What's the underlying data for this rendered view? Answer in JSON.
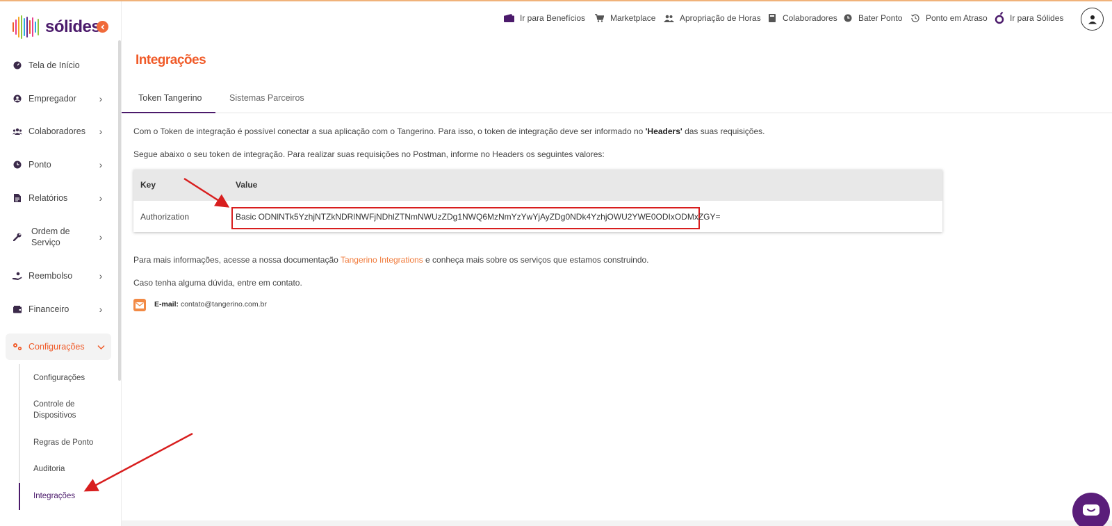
{
  "brand": {
    "name": "sólides",
    "bar_colors": [
      "#f05a28",
      "#e83e8c",
      "#f5a623",
      "#8cc63f",
      "#29abe2",
      "#662d91",
      "#f05a28",
      "#e83e8c",
      "#29abe2",
      "#8cc63f"
    ]
  },
  "colors": {
    "accent": "#f05a28",
    "brand_purple": "#4b1a6b",
    "highlight_red": "#d81e1e",
    "link": "#f07a3a"
  },
  "topbar": {
    "items": [
      {
        "label": "Ir para Benefícios",
        "icon": "wallet-icon"
      },
      {
        "label": "Marketplace",
        "icon": "cart-icon"
      },
      {
        "label": "Apropriação de Horas",
        "icon": "people-icon"
      },
      {
        "label": "Colaboradores",
        "icon": "book-icon"
      },
      {
        "label": "Bater Ponto",
        "icon": "clock-icon"
      },
      {
        "label": "Ponto em Atraso",
        "icon": "history-icon"
      },
      {
        "label": "Ir para Sólides",
        "icon": "solides-icon"
      }
    ]
  },
  "sidebar": {
    "items": [
      {
        "label": "Tela de Início",
        "icon": "dashboard-icon"
      },
      {
        "label": "Empregador",
        "icon": "user-circle-icon"
      },
      {
        "label": "Colaboradores",
        "icon": "users-icon"
      },
      {
        "label": "Ponto",
        "icon": "clock-icon"
      },
      {
        "label": "Relatórios",
        "icon": "document-icon"
      },
      {
        "label": "Ordem de Serviço",
        "icon": "wrench-icon"
      },
      {
        "label": "Reembolso",
        "icon": "hand-coin-icon"
      },
      {
        "label": "Financeiro",
        "icon": "wallet-icon"
      },
      {
        "label": "Configurações",
        "icon": "gears-icon"
      }
    ],
    "subitems": [
      {
        "label": "Configurações"
      },
      {
        "label": "Controle de Dispositivos"
      },
      {
        "label": "Regras de Ponto"
      },
      {
        "label": "Auditoria"
      },
      {
        "label": "Integrações"
      }
    ]
  },
  "main": {
    "title": "Integrações",
    "tabs": [
      {
        "label": "Token Tangerino"
      },
      {
        "label": "Sistemas Parceiros"
      }
    ],
    "intro_a": "Com o Token de integração é possível conectar a sua aplicação com o Tangerino. Para isso, o token de integração deve ser informado no ",
    "intro_bold": "'Headers'",
    "intro_b": " das suas requisições.",
    "below": "Segue abaixo o seu token de integração. Para realizar suas requisições no Postman, informe no Headers os seguintes valores:",
    "table": {
      "headers": [
        "Key",
        "Value"
      ],
      "rows": [
        [
          "Authorization",
          "Basic ODNlNTk5YzhjNTZkNDRlNWFjNDhlZTNmNWUzZDg1NWQ6MzNmYzYwYjAyZDg0NDk4YzhjOWU2YWE0ODIxODMxZGY="
        ]
      ]
    },
    "more_a": "Para mais informações, acesse a nossa documentação ",
    "more_link": "Tangerino Integrations",
    "more_b": " e conheça mais sobre os serviços que estamos construindo.",
    "contact": "Caso tenha alguma dúvida, entre em contato.",
    "email_label": "E-mail:",
    "email": "contato@tangerino.com.br"
  }
}
